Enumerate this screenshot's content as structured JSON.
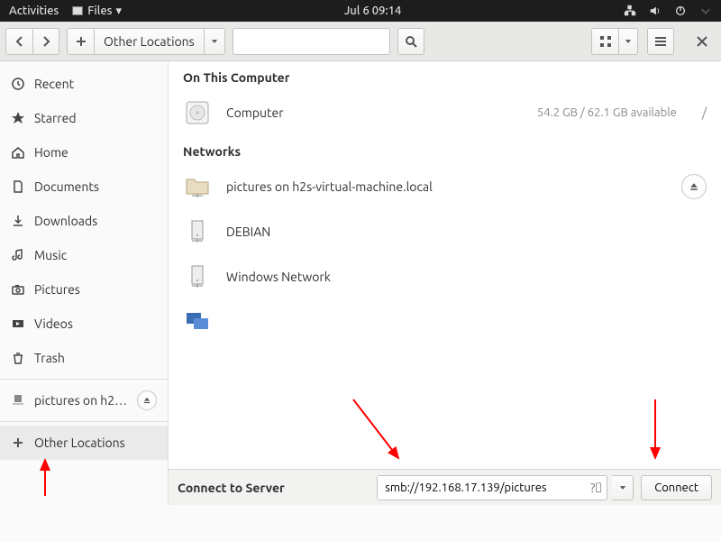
{
  "topbar": {
    "activities": "Activities",
    "app": "Files",
    "clock": "Jul 6  09:14"
  },
  "toolbar": {
    "location": "Other Locations"
  },
  "sidebar": {
    "items": [
      {
        "icon": "clock",
        "label": "Recent"
      },
      {
        "icon": "star",
        "label": "Starred"
      },
      {
        "icon": "home",
        "label": "Home"
      },
      {
        "icon": "doc",
        "label": "Documents"
      },
      {
        "icon": "download",
        "label": "Downloads"
      },
      {
        "icon": "music",
        "label": "Music"
      },
      {
        "icon": "camera",
        "label": "Pictures"
      },
      {
        "icon": "video",
        "label": "Videos"
      },
      {
        "icon": "trash",
        "label": "Trash"
      }
    ],
    "mount": {
      "label": "pictures on h2…"
    },
    "other": {
      "label": "Other Locations"
    }
  },
  "content": {
    "section1": "On This Computer",
    "computer": {
      "label": "Computer",
      "meta": "54.2 GB / 62.1 GB available",
      "path": "/"
    },
    "section2": "Networks",
    "net": [
      {
        "label": "pictures on h2s-virtual-machine.local"
      },
      {
        "label": "DEBIAN"
      },
      {
        "label": "Windows Network"
      }
    ]
  },
  "footer": {
    "label": "Connect to Server",
    "address": "smb://192.168.17.139/pictures",
    "connect": "Connect"
  }
}
